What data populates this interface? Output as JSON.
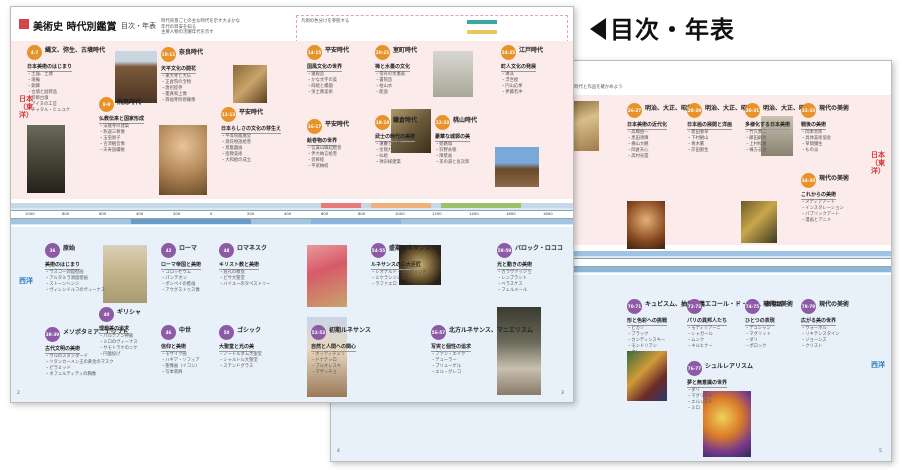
{
  "heading": {
    "text": "目次・年表"
  },
  "front": {
    "title": "美術史 時代別鑑賞",
    "title_sub": "目次・年表",
    "header_notes": [
      "時代背景ごとの主な時代を示す大まかな",
      "年代の目安を知る",
      "主要人物の活躍年代を示す",
      "凡例の色分けを参照する"
    ],
    "page_left": "2",
    "page_right": "3",
    "side_japan": "日本（東洋）",
    "side_west": "西洋",
    "japan_boxes": [
      {
        "pages": "4-7",
        "name": "縄文、弥生、古墳時代",
        "sub": "日本美術のはじまり",
        "items": [
          "土器、土偶",
          "埴輪",
          "銅鐸",
          "古墳と副葬品",
          "装飾古墳",
          "アイヌの工芸",
          "チャタル・ヒュユク"
        ]
      },
      {
        "pages": "8-9",
        "name": "飛鳥時代",
        "sub": "仏教伝来と国家形成",
        "items": [
          "法隆寺の建築",
          "釈迦三尊像",
          "玉虫厨子",
          "百済観音像",
          "天寿国繡帳"
        ]
      },
      {
        "pages": "10-11",
        "name": "奈良時代",
        "sub": "天平文化の開花",
        "items": [
          "東大寺と大仏",
          "正倉院の宝物",
          "唐招提寺",
          "鑑真和上像",
          "興福寺阿修羅像"
        ]
      },
      {
        "pages": "12-13",
        "name": "平安時代",
        "sub": "日本らしさの文化の芽生え",
        "items": [
          "平等院鳳凰堂",
          "源氏物語絵巻",
          "鳥獣戯画",
          "密教美術",
          "大和絵の成立"
        ]
      },
      {
        "pages": "14-15",
        "name": "平安時代",
        "sub": "国風文化の世界",
        "items": [
          "寝殿造",
          "かな文字の美",
          "蒔絵と螺鈿",
          "浄土教美術"
        ]
      },
      {
        "pages": "16-17",
        "name": "平安時代",
        "sub": "絵巻物の世界",
        "items": [
          "信貴山縁起絵巻",
          "伴大納言絵巻",
          "装飾経",
          "平家納経"
        ]
      },
      {
        "pages": "18-19",
        "name": "鎌倉時代",
        "sub": "武士の時代の美術",
        "items": [
          "運慶と快慶",
          "金剛力士像",
          "似絵",
          "禅宗様建築"
        ]
      },
      {
        "pages": "20-21",
        "name": "室町時代",
        "sub": "禅と水墨の文化",
        "items": [
          "雪舟の水墨画",
          "書院造",
          "枯山水",
          "能面"
        ]
      },
      {
        "pages": "22-23",
        "name": "桃山時代",
        "sub": "豪華な城郭の美",
        "items": [
          "姫路城",
          "狩野永徳",
          "障壁画",
          "茶の湯と長次郎"
        ]
      },
      {
        "pages": "24-25",
        "name": "江戸時代",
        "sub": "町人文化の発展",
        "items": [
          "琳派",
          "浮世絵",
          "円山応挙",
          "伊藤若冲"
        ]
      }
    ],
    "west_boxes": [
      {
        "pages": "36",
        "name": "原始",
        "sub": "美術のはじまり",
        "items": [
          "ラスコー洞窟壁画",
          "アルタミラ洞窟壁画",
          "ストーンヘンジ",
          "ヴィレンドルフのヴィーナス"
        ]
      },
      {
        "pages": "38-39",
        "name": "メソポタミア、エジプト",
        "sub": "古代文明の美術",
        "items": [
          "ウルのスタンダード",
          "ツタンカーメン王の黄金のマスク",
          "ピラミッド",
          "ネフェルティティの胸像"
        ]
      },
      {
        "pages": "40",
        "name": "ギリシャ",
        "sub": "理想美の追求",
        "items": [
          "パルテノン神殿",
          "ミロのヴィーナス",
          "サモトラケのニケ",
          "円盤投げ"
        ]
      },
      {
        "pages": "42",
        "name": "ローマ",
        "sub": "ローマ帝国と美術",
        "items": [
          "コロッセウム",
          "パンテオン",
          "ポンペイの壁画",
          "アウグストゥス像"
        ]
      },
      {
        "pages": "46",
        "name": "中世",
        "sub": "信仰と美術",
        "items": [
          "モザイク画",
          "ハギア・ソフィア",
          "聖像画（イコン）",
          "写本装飾"
        ]
      },
      {
        "pages": "48",
        "name": "ロマネスク",
        "sub": "キリスト教と美術",
        "items": [
          "巡礼の教会",
          "ピサ大聖堂",
          "バイユーのタペストリー"
        ]
      },
      {
        "pages": "50",
        "name": "ゴシック",
        "sub": "大聖堂と光の美",
        "items": [
          "ノートルダム大聖堂",
          "シャルトル大聖堂",
          "ステンドグラス"
        ]
      },
      {
        "pages": "52-53",
        "name": "初期ルネサンス",
        "sub": "自然と人間への関心",
        "items": [
          "ボッティチェリ",
          "ドナテッロ",
          "ブルネレスキ",
          "マザッチョ"
        ]
      },
      {
        "pages": "54-55",
        "name": "盛期ルネサンス",
        "sub": "ルネサンスの三大巨匠",
        "items": [
          "レオナルド・ダ・ヴィンチ",
          "ミケランジェロ",
          "ラファエロ"
        ]
      },
      {
        "pages": "56-57",
        "name": "北方ルネサンス、マニエリスム",
        "sub": "写実と個性の追求",
        "items": [
          "ファン・エイク",
          "デューラー",
          "ブリューゲル",
          "エル・グレコ"
        ]
      },
      {
        "pages": "58-59",
        "name": "バロック・ロココ",
        "sub": "光と動きの美術",
        "items": [
          "カラヴァッジョ",
          "レンブラント",
          "ベラスケス",
          "フェルメール"
        ]
      }
    ],
    "timeline_years": [
      "1000",
      "800",
      "600",
      "400",
      "200",
      "0",
      "200",
      "400",
      "600",
      "800",
      "1000",
      "1200",
      "1400",
      "1600",
      "1800"
    ]
  },
  "back": {
    "header_note": "年表で時代と作品を確かめよう",
    "page_left": "4",
    "page_right": "5",
    "side_japan": "日本（東洋）",
    "side_west": "西洋",
    "japan_boxes": [
      {
        "pages": "26-27",
        "name": "明治、大正、昭和",
        "sub": "日本美術の近代化",
        "items": [
          "高橋由一",
          "黒田清輝",
          "横山大観",
          "岡倉天心",
          "高村光雲"
        ]
      },
      {
        "pages": "28-29",
        "name": "明治、大正、昭和",
        "sub": "日本画の展開と洋画",
        "items": [
          "菱田春草",
          "下村観山",
          "青木繁",
          "岸田劉生"
        ]
      },
      {
        "pages": "30-31",
        "name": "明治、大正、昭和",
        "sub": "多様化する日本美術",
        "items": [
          "竹久夢二",
          "藤田嗣治",
          "上村松園",
          "棟方志功"
        ]
      },
      {
        "pages": "32-33",
        "name": "現代の美術",
        "sub": "戦後の美術",
        "items": [
          "岡本太郎",
          "具体美術協会",
          "草間彌生",
          "もの派"
        ]
      },
      {
        "pages": "34-35",
        "name": "現代の美術",
        "sub": "これからの美術",
        "items": [
          "メディアアート",
          "インスタレーション",
          "パブリックアート",
          "漫画とアニメ"
        ]
      }
    ],
    "west_boxes": [
      {
        "pages": "70-71",
        "name": "キュビスム、抽象主義",
        "sub": "形と色彩への挑戦",
        "items": [
          "ピカソ",
          "ブラック",
          "カンディンスキー",
          "モンドリアン",
          "クレー"
        ]
      },
      {
        "pages": "72-73",
        "name": "エコール・ド・パリ、表現派",
        "sub": "パリの異邦人たち",
        "items": [
          "モディリアーニ",
          "シャガール",
          "ムンク",
          "キルヒナー"
        ]
      },
      {
        "pages": "74-75",
        "name": "現代の美術",
        "sub": "ひとつの表現",
        "items": [
          "デュシャン",
          "マグリット",
          "ダリ",
          "ポロック"
        ]
      },
      {
        "pages": "76-77",
        "name": "シュルレアリスム",
        "sub": "夢と無意識の世界",
        "items": [
          "ダリ",
          "マグリット",
          "エルンスト",
          "ミロ"
        ]
      },
      {
        "pages": "78-79",
        "name": "現代の美術",
        "sub": "広がる美の世界",
        "items": [
          "ウォーホル",
          "リキテンスタイン",
          "ジョーンズ",
          "クリスト"
        ]
      }
    ]
  }
}
